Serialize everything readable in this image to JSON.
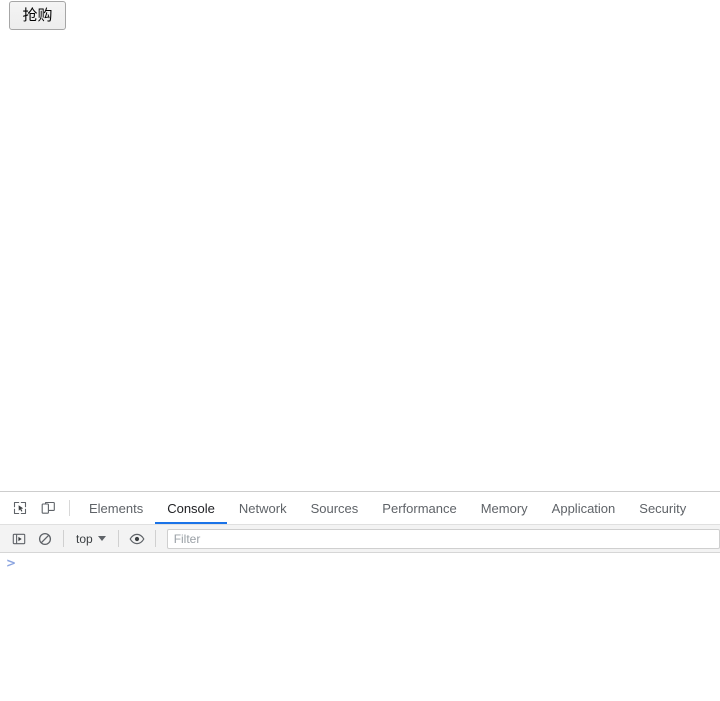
{
  "page": {
    "buy_button_label": "抢购"
  },
  "devtools": {
    "toolbar_icons": {
      "inspect": "inspect-element-icon",
      "device": "device-toolbar-icon"
    },
    "tabs": [
      {
        "label": "Elements",
        "active": false
      },
      {
        "label": "Console",
        "active": true
      },
      {
        "label": "Network",
        "active": false
      },
      {
        "label": "Sources",
        "active": false
      },
      {
        "label": "Performance",
        "active": false
      },
      {
        "label": "Memory",
        "active": false
      },
      {
        "label": "Application",
        "active": false
      },
      {
        "label": "Security",
        "active": false
      }
    ],
    "console_toolbar": {
      "sidebar_icon": "console-sidebar-icon",
      "clear_icon": "clear-console-icon",
      "context_label": "top",
      "eye_icon": "live-expression-eye-icon",
      "filter_placeholder": "Filter",
      "filter_value": ""
    },
    "console": {
      "prompt_symbol": ">",
      "prompt_value": ""
    },
    "colors": {
      "active_tab_underline": "#1a73e8",
      "prompt": "#8ba4e0",
      "toolbar_bg": "#f3f3f3"
    }
  }
}
